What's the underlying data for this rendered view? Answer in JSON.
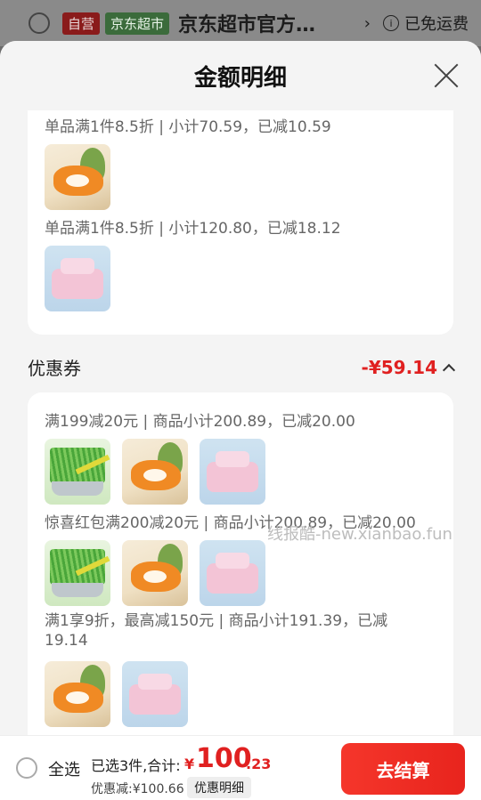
{
  "store": {
    "self_badge": "自营",
    "channel_badge": "京东超市",
    "name": "京东超市官方…",
    "arrow": "›",
    "info_icon": "i",
    "shipping": "已免运费"
  },
  "sheet": {
    "title": "金额明细"
  },
  "promo_card": {
    "rule_1": "单品满1件8.5折 | 小计70.59，已减10.59",
    "rule_2": "单品满1件8.5折 | 小计120.80，已减18.12"
  },
  "coupon_section": {
    "label": "优惠券",
    "amount": "-¥59.14"
  },
  "coupon_card": {
    "rule_1": "满199减20元 | 商品小计200.89，已减20.00",
    "rule_2": "惊喜红包满200减20元 | 商品小计200.89，已减20.00",
    "rule_3": "满1享9折，最高减150元 | 商品小计191.39，已减19.14"
  },
  "watermark": "线报酷-new.xianbao.fun",
  "bottom_bar": {
    "select_all": "全选",
    "selected_total": "已选3件,合计:",
    "currency": "¥",
    "price_int": "100",
    "price_dec": ".23",
    "discount": "优惠减:¥100.66",
    "detail_button": "优惠明细",
    "checkout": "去结算"
  },
  "colors": {
    "accent": "#e02020",
    "checkout": "#f5362b"
  }
}
